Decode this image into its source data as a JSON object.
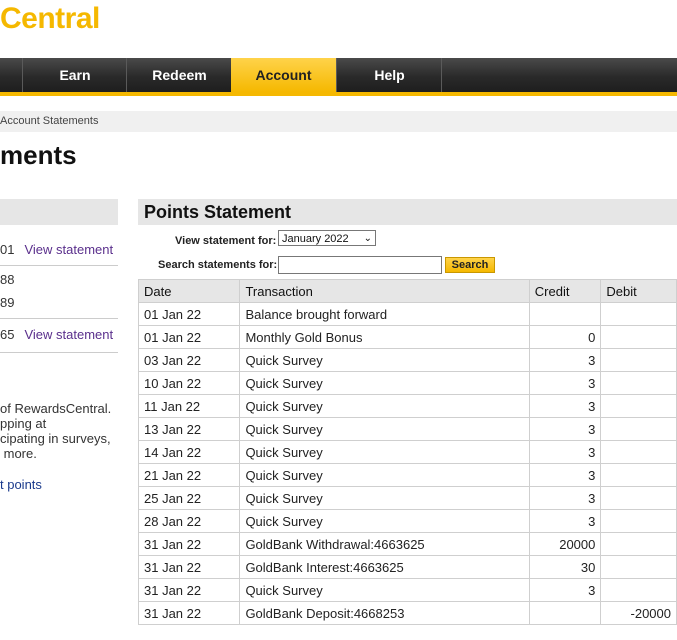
{
  "header": {
    "logo_text": "Central",
    "logo_mark": "™"
  },
  "nav": {
    "items": [
      {
        "label": "Earn",
        "active": false
      },
      {
        "label": "Redeem",
        "active": false
      },
      {
        "label": "Account",
        "active": true
      },
      {
        "label": "Help",
        "active": false
      }
    ]
  },
  "breadcrumb": {
    "text": "Account Statements"
  },
  "page_title": "ments",
  "left": {
    "rows": [
      {
        "num": "01",
        "link": "View statement"
      },
      {
        "num": "88",
        "link": ""
      },
      {
        "num": "89",
        "link": ""
      },
      {
        "num": "65",
        "link": "View statement"
      }
    ],
    "text": "of RewardsCentral.\npping at\ncipating in surveys,\n more.",
    "link": "t points"
  },
  "panel": {
    "title": "Points Statement",
    "view_label": "View statement for:",
    "selected_month": "January 2022",
    "search_label": "Search statements for:",
    "search_value": "",
    "search_button": "Search"
  },
  "table": {
    "columns": [
      "Date",
      "Transaction",
      "Credit",
      "Debit"
    ],
    "rows": [
      {
        "date": "01 Jan 22",
        "transaction": "Balance brought forward",
        "credit": "",
        "debit": ""
      },
      {
        "date": "01 Jan 22",
        "transaction": "Monthly Gold Bonus",
        "credit": "0",
        "debit": ""
      },
      {
        "date": "03 Jan 22",
        "transaction": "Quick Survey",
        "credit": "3",
        "debit": ""
      },
      {
        "date": "10 Jan 22",
        "transaction": "Quick Survey",
        "credit": "3",
        "debit": ""
      },
      {
        "date": "11 Jan 22",
        "transaction": "Quick Survey",
        "credit": "3",
        "debit": ""
      },
      {
        "date": "13 Jan 22",
        "transaction": "Quick Survey",
        "credit": "3",
        "debit": ""
      },
      {
        "date": "14 Jan 22",
        "transaction": "Quick Survey",
        "credit": "3",
        "debit": ""
      },
      {
        "date": "21 Jan 22",
        "transaction": "Quick Survey",
        "credit": "3",
        "debit": ""
      },
      {
        "date": "25 Jan 22",
        "transaction": "Quick Survey",
        "credit": "3",
        "debit": ""
      },
      {
        "date": "28 Jan 22",
        "transaction": "Quick Survey",
        "credit": "3",
        "debit": ""
      },
      {
        "date": "31 Jan 22",
        "transaction": "GoldBank Withdrawal:4663625",
        "credit": "20000",
        "debit": ""
      },
      {
        "date": "31 Jan 22",
        "transaction": "GoldBank Interest:4663625",
        "credit": "30",
        "debit": ""
      },
      {
        "date": "31 Jan 22",
        "transaction": "Quick Survey",
        "credit": "3",
        "debit": ""
      },
      {
        "date": "31 Jan 22",
        "transaction": "GoldBank Deposit:4668253",
        "credit": "",
        "debit": "-20000"
      }
    ]
  }
}
